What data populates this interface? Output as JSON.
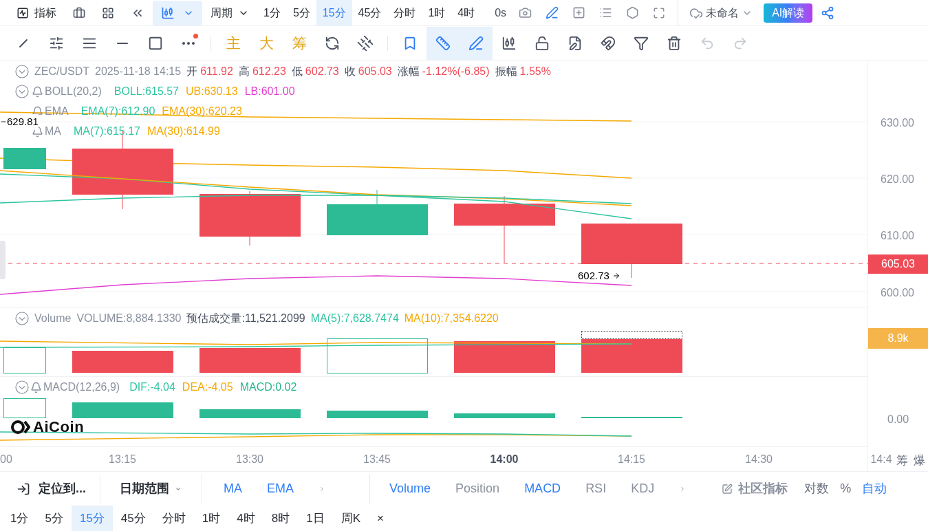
{
  "top_bar": {
    "indicator_button": "指标",
    "chart_type": {
      "selected": true
    },
    "period_dropdown": "周期",
    "periods": [
      {
        "label": "1分",
        "selected": false
      },
      {
        "label": "5分",
        "selected": false
      },
      {
        "label": "15分",
        "selected": true
      },
      {
        "label": "45分",
        "selected": false
      },
      {
        "label": "分时",
        "selected": false
      },
      {
        "label": "1时",
        "selected": false
      },
      {
        "label": "4时",
        "selected": false
      }
    ],
    "countdown": "0s",
    "drawing_mode": {
      "on": true
    },
    "layout_name": "未命名",
    "ai_button": "AI解读"
  },
  "toolbar": {
    "more_tools": {
      "has_notice": true
    },
    "text_tools": [
      "主",
      "大",
      "筹"
    ],
    "measure_tool": {
      "selected": true
    },
    "brush_tool": {
      "selected": true
    },
    "undo": {
      "disabled": true
    },
    "redo": {
      "disabled": true
    }
  },
  "main_pane": {
    "symbol": "ZEC/USDT",
    "time": "2025-11-18 14:15",
    "quote": [
      {
        "label": "开",
        "value": "611.92"
      },
      {
        "label": "高",
        "value": "612.23"
      },
      {
        "label": "低",
        "value": "602.73"
      },
      {
        "label": "收",
        "value": "605.03"
      },
      {
        "label": "涨幅",
        "value": "-1.12%(-6.85)"
      },
      {
        "label": "振幅",
        "value": "1.55%"
      }
    ],
    "indicators": [
      {
        "name": "BOLL(20,2)",
        "collapsible": true,
        "values": [
          {
            "text": "BOLL:615.57",
            "color": "#2ec4a0"
          },
          {
            "text": "UB:630.13",
            "color": "#f5a800"
          },
          {
            "text": "LB:601.00",
            "color": "#e23fd0"
          }
        ]
      },
      {
        "name": "EMA",
        "collapsible": false,
        "values": [
          {
            "text": "EMA(7):612.90",
            "color": "#2ec4a0"
          },
          {
            "text": "EMA(30):620.23",
            "color": "#f5a800"
          }
        ]
      },
      {
        "name": "MA",
        "collapsible": false,
        "values": [
          {
            "text": "MA(7):615.17",
            "color": "#2ec4a0"
          },
          {
            "text": "MA(30):614.99",
            "color": "#f5a800"
          }
        ]
      }
    ],
    "high_marker": "629.81",
    "low_marker": "602.73"
  },
  "volume_pane": {
    "name": "Volume",
    "values": [
      {
        "text": "VOLUME:8,884.1330",
        "color": "#8a919e"
      },
      {
        "text": "预估成交量:11,521.2099",
        "color": "#4a5160"
      },
      {
        "text": "MA(5):7,628.7474",
        "color": "#2ec4a0"
      },
      {
        "text": "MA(10):7,354.6220",
        "color": "#f5a800"
      }
    ]
  },
  "macd_pane": {
    "name": "MACD(12,26,9)",
    "values": [
      {
        "text": "DIF:-4.04",
        "color": "#2ec4a0"
      },
      {
        "text": "DEA:-4.05",
        "color": "#f5a800"
      },
      {
        "text": "MACD:0.02",
        "color": "#26b58c"
      }
    ],
    "logo": "AiCoin"
  },
  "price_axis": {
    "ticks": [
      "630.00",
      "620.00",
      "610.00",
      "600.00"
    ],
    "last_price": "605.03",
    "volume_tag": "8.9k",
    "macd_tick": "0.00"
  },
  "time_axis": {
    "ticks": [
      {
        "label": "00",
        "major": false
      },
      {
        "label": "13:15",
        "major": false
      },
      {
        "label": "13:30",
        "major": false
      },
      {
        "label": "13:45",
        "major": false
      },
      {
        "label": "14:00",
        "major": true
      },
      {
        "label": "14:15",
        "major": false
      },
      {
        "label": "14:30",
        "major": false
      },
      {
        "label": "14:4",
        "major": false
      }
    ],
    "buttons": [
      "筹",
      "爆"
    ]
  },
  "bottom_bar": {
    "locate": "定位到...",
    "date_range": "日期范围",
    "main_indicators": [
      {
        "label": "MA",
        "active": true
      },
      {
        "label": "EMA",
        "active": true
      }
    ],
    "sub_indicators": [
      {
        "label": "Volume",
        "active": true
      },
      {
        "label": "Position",
        "active": false
      },
      {
        "label": "MACD",
        "active": true
      },
      {
        "label": "RSI",
        "active": false
      },
      {
        "label": "KDJ",
        "active": false
      }
    ],
    "community": "社区指标",
    "scale_options": [
      {
        "label": "对数",
        "active": false
      },
      {
        "label": "%",
        "active": false
      },
      {
        "label": "自动",
        "active": true
      }
    ]
  },
  "period_row": {
    "periods": [
      {
        "label": "1分",
        "selected": false
      },
      {
        "label": "5分",
        "selected": false
      },
      {
        "label": "15分",
        "selected": true
      },
      {
        "label": "45分",
        "selected": false
      },
      {
        "label": "分时",
        "selected": false
      },
      {
        "label": "1时",
        "selected": false
      },
      {
        "label": "4时",
        "selected": false
      },
      {
        "label": "8时",
        "selected": false
      },
      {
        "label": "1日",
        "selected": false
      },
      {
        "label": "周K",
        "selected": false
      }
    ],
    "close": "×"
  }
}
